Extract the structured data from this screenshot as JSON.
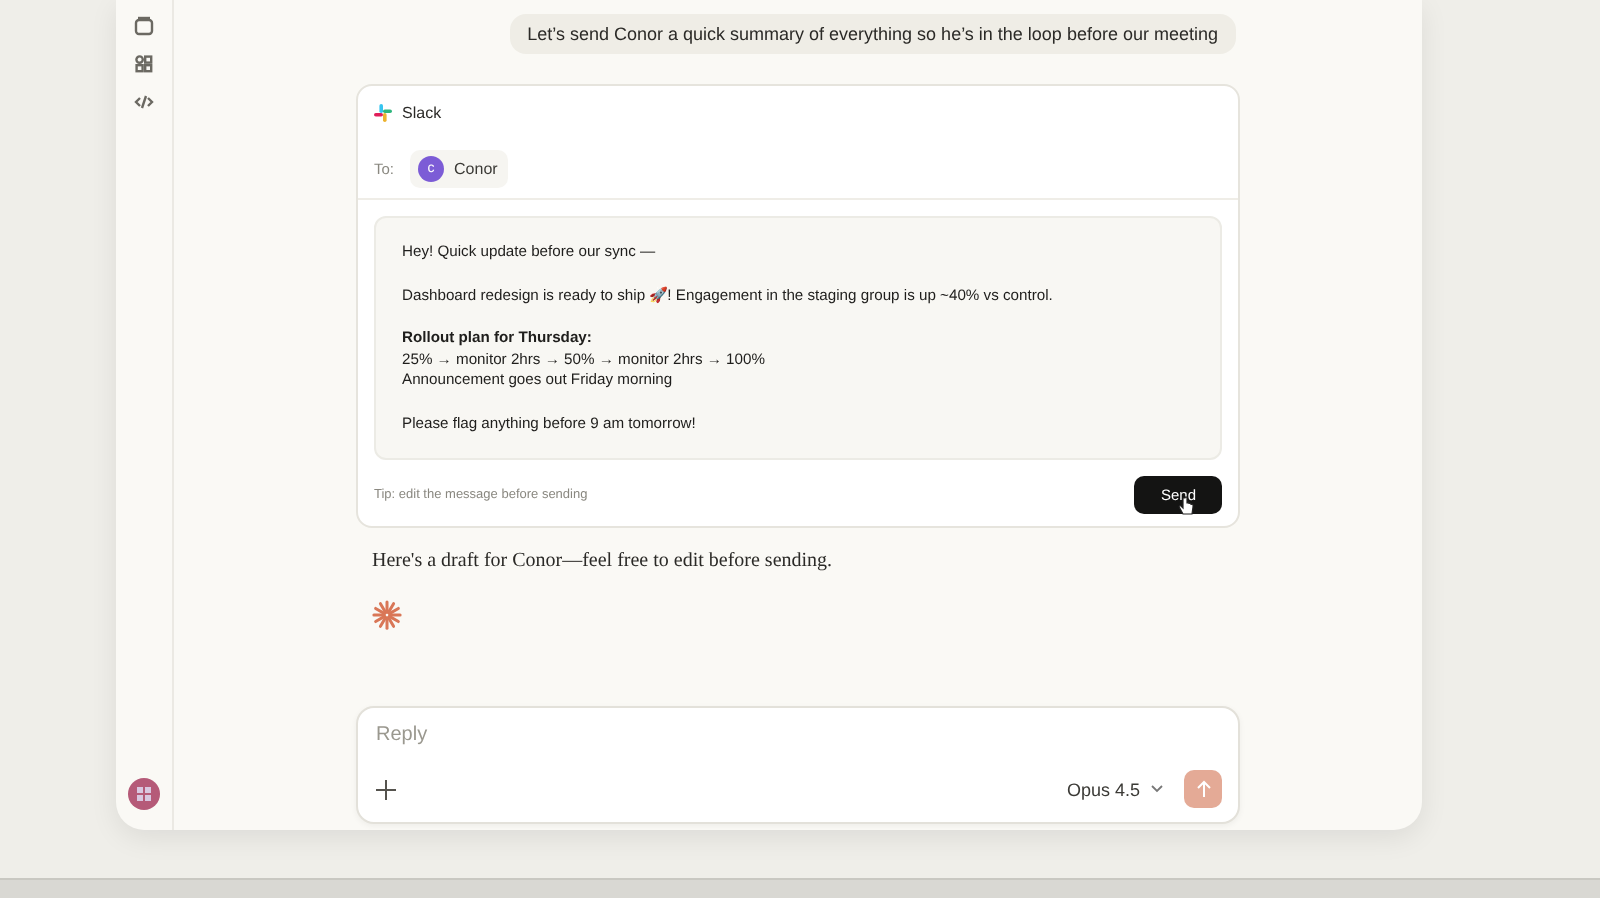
{
  "user_message": "Let’s send Conor a quick summary of everything so he’s in the loop before our meeting",
  "slack_card": {
    "app": "Slack",
    "to_label": "To:",
    "recipient": {
      "initial": "c",
      "name": "Conor",
      "color": "#7c5cd6"
    },
    "message": [
      {
        "lines": [
          {
            "kind": "plain",
            "text": "Hey! Quick update before our sync —"
          }
        ]
      },
      {
        "lines": [
          {
            "kind": "plain",
            "text": "Dashboard redesign is ready to ship 🚀! Engagement in the staging group is up ~40% vs control."
          }
        ]
      },
      {
        "lines": [
          {
            "kind": "bold",
            "text": "Rollout plan for Thursday:"
          },
          {
            "kind": "plain",
            "text": "25% → monitor 2hrs → 50% → monitor 2hrs → 100%"
          },
          {
            "kind": "plain",
            "text": "Announcement goes out Friday morning"
          }
        ]
      },
      {
        "lines": [
          {
            "kind": "plain",
            "text": "Please flag anything before 9 am tomorrow!"
          }
        ]
      }
    ],
    "tip": "Tip: edit the message before sending",
    "send_label": "Send"
  },
  "assistant_message": "Here's a draft for Conor—feel free to edit before sending.",
  "composer": {
    "placeholder": "Reply",
    "model": "Opus 4.5",
    "send_disabled": true
  }
}
